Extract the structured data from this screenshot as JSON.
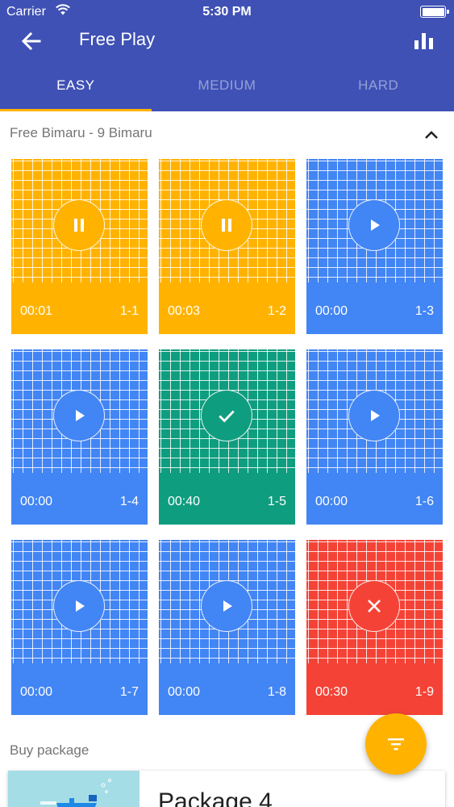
{
  "status_bar": {
    "carrier": "Carrier",
    "time": "5:30 PM"
  },
  "header": {
    "title": "Free Play"
  },
  "tabs": [
    {
      "label": "EASY",
      "active": true
    },
    {
      "label": "MEDIUM",
      "active": false
    },
    {
      "label": "HARD",
      "active": false
    }
  ],
  "section": {
    "title": "Free Bimaru - 9 Bimaru"
  },
  "puzzles": [
    {
      "time": "00:01",
      "level": "1-1",
      "state": "paused",
      "icon": "pause-icon",
      "color": "#ffb300"
    },
    {
      "time": "00:03",
      "level": "1-2",
      "state": "paused",
      "icon": "pause-icon",
      "color": "#ffb300"
    },
    {
      "time": "00:00",
      "level": "1-3",
      "state": "new",
      "icon": "play-icon",
      "color": "#4285f4"
    },
    {
      "time": "00:00",
      "level": "1-4",
      "state": "new",
      "icon": "play-icon",
      "color": "#4285f4"
    },
    {
      "time": "00:40",
      "level": "1-5",
      "state": "solved",
      "icon": "check-icon",
      "color": "#0f9d7f"
    },
    {
      "time": "00:00",
      "level": "1-6",
      "state": "new",
      "icon": "play-icon",
      "color": "#4285f4"
    },
    {
      "time": "00:00",
      "level": "1-7",
      "state": "new",
      "icon": "play-icon",
      "color": "#4285f4"
    },
    {
      "time": "00:00",
      "level": "1-8",
      "state": "new",
      "icon": "play-icon",
      "color": "#4285f4"
    },
    {
      "time": "00:30",
      "level": "1-9",
      "state": "failed",
      "icon": "close-icon",
      "color": "#f44336"
    }
  ],
  "buy": {
    "title": "Buy package",
    "package_name": "Package 4"
  },
  "colors": {
    "primary": "#3f51b5",
    "accent": "#ffb300"
  }
}
